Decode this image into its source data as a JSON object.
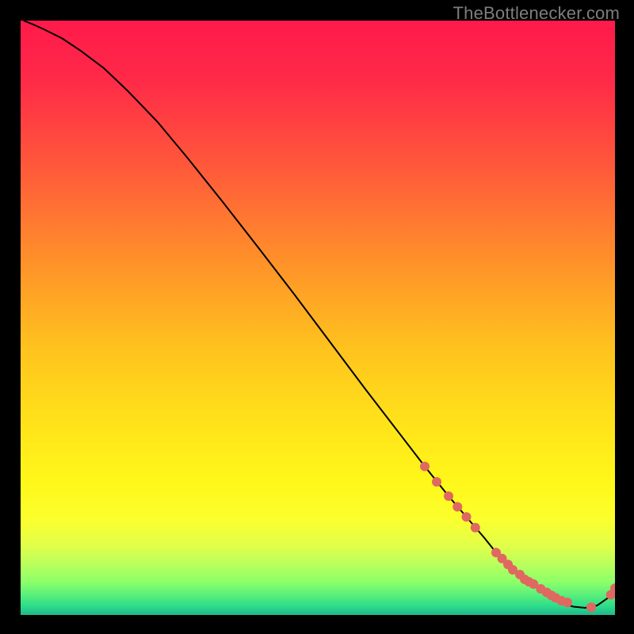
{
  "watermark": "TheBottlenecker.com",
  "gradient": {
    "stops": [
      {
        "offset": 0.0,
        "color": "#ff1a4b"
      },
      {
        "offset": 0.1,
        "color": "#ff2a48"
      },
      {
        "offset": 0.25,
        "color": "#ff5a3a"
      },
      {
        "offset": 0.4,
        "color": "#ff8f2a"
      },
      {
        "offset": 0.55,
        "color": "#ffc21e"
      },
      {
        "offset": 0.68,
        "color": "#ffe31a"
      },
      {
        "offset": 0.78,
        "color": "#fff81a"
      },
      {
        "offset": 0.84,
        "color": "#fbff2e"
      },
      {
        "offset": 0.885,
        "color": "#e0ff4a"
      },
      {
        "offset": 0.915,
        "color": "#b8ff5c"
      },
      {
        "offset": 0.945,
        "color": "#8cff6a"
      },
      {
        "offset": 0.965,
        "color": "#5cf07a"
      },
      {
        "offset": 0.985,
        "color": "#2edc8a"
      },
      {
        "offset": 1.0,
        "color": "#1fb88c"
      }
    ]
  },
  "chart_data": {
    "type": "line",
    "title": "",
    "xlabel": "",
    "ylabel": "",
    "xlim": [
      0,
      100
    ],
    "ylim": [
      0,
      100
    ],
    "series": [
      {
        "name": "curve",
        "x": [
          0.5,
          2,
          4,
          7,
          10,
          14,
          18,
          23,
          28,
          34,
          40,
          46,
          52,
          58,
          63,
          68,
          72,
          75,
          78,
          80,
          82,
          84,
          86,
          88,
          89.5,
          91,
          93,
          95,
          97,
          99,
          100
        ],
        "y": [
          100,
          99.4,
          98.5,
          97.0,
          95.0,
          92.0,
          88.2,
          83.0,
          77.0,
          69.5,
          61.8,
          54.0,
          46.0,
          38.0,
          31.5,
          25.0,
          20.0,
          16.5,
          13.0,
          10.5,
          8.5,
          6.8,
          5.2,
          3.8,
          2.8,
          2.0,
          1.4,
          1.2,
          1.6,
          3.0,
          4.5
        ]
      },
      {
        "name": "points",
        "x": [
          68,
          70,
          72,
          73.5,
          75,
          76.5,
          80,
          81,
          82,
          82.8,
          84,
          84.8,
          85.5,
          86.3,
          87.5,
          88.5,
          89.3,
          90,
          91,
          92,
          96,
          99.3,
          100
        ],
        "y": [
          25.0,
          22.4,
          20.0,
          18.2,
          16.5,
          14.7,
          10.5,
          9.5,
          8.5,
          7.6,
          6.8,
          6.0,
          5.6,
          5.2,
          4.4,
          3.8,
          3.3,
          2.9,
          2.4,
          2.1,
          1.3,
          3.4,
          4.5
        ]
      }
    ]
  }
}
